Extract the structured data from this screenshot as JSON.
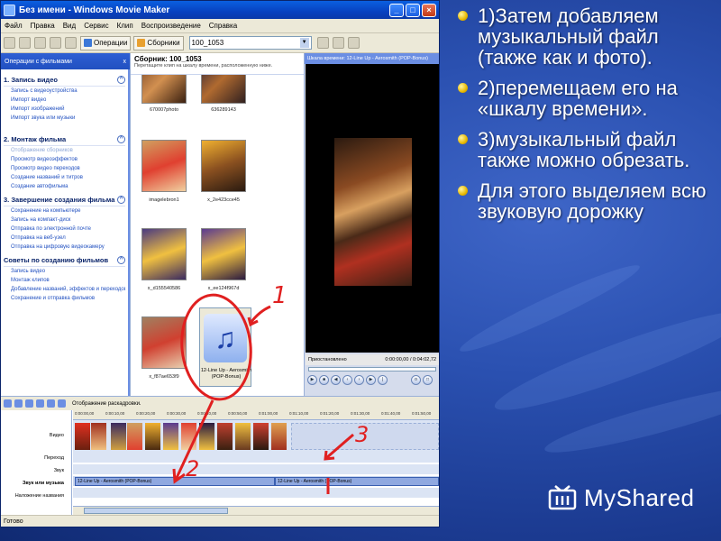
{
  "window": {
    "title": "Без имени - Windows Movie Maker",
    "menu": [
      "Файл",
      "Правка",
      "Вид",
      "Сервис",
      "Клип",
      "Воспроизведение",
      "Справка"
    ],
    "toolbar": {
      "operations_label": "Операции",
      "collections_label": "Сборники",
      "collection_value": "100_1053"
    }
  },
  "tasks": {
    "header": "Операции с фильмами",
    "close": "x",
    "sections": [
      {
        "title": "1. Запись видео",
        "links": [
          "Запись с видеоустройства",
          "Импорт видео",
          "Импорт изображений",
          "Импорт звука или музыки"
        ]
      },
      {
        "title": "2. Монтаж фильма",
        "links": [
          "Отображение сборников",
          "Просмотр видеоэффектов",
          "Просмотр видео переходов",
          "Создание названий и титров",
          "Создание автофильма"
        ]
      },
      {
        "title": "3. Завершение создания фильма",
        "links": [
          "Сохранение на компьютере",
          "Запись на компакт-диск",
          "Отправка по электронной почте",
          "Отправка на веб-узел",
          "Отправка на цифровую видеокамеру"
        ]
      },
      {
        "title": "Советы по созданию фильмов",
        "links": [
          "Запись видео",
          "Монтаж клипов",
          "Добавление названий, эффектов и переходов",
          "Сохранение и отправка фильмов"
        ]
      }
    ]
  },
  "collection": {
    "title": "Сборник: 100_1053",
    "hint": "Перетащите клип на шкалу времени, расположенную ниже.",
    "thumbs": [
      "670007photo",
      "636289143",
      "imagelebron1",
      "x_2e423cce45",
      "x_d155540586",
      "x_ee124f967d",
      "x_f87ae653f9"
    ],
    "music_clip": "12-Line Up - Aerosmith (POP-Bonus)"
  },
  "preview": {
    "header": "Шкала времени: 12-Line Up - Aerosmith (POP-Bonus)",
    "status": "Приостановлено",
    "time": "0:00:00,00 / 0:04:02,72"
  },
  "timeline": {
    "toolbar_label": "Отображение раскадровки.",
    "tracks": [
      "Видео",
      "Переход",
      "Звук",
      "Звук или музыка",
      "Наложение названия"
    ],
    "ruler": [
      "0:00:00,00",
      "0:00:10,00",
      "0:00:20,00",
      "0:00:30,00",
      "0:00:40,00",
      "0:00:50,00",
      "0:01:00,00",
      "0:01:10,00",
      "0:01:20,00",
      "0:01:30,00",
      "0:01:40,00",
      "0:01:50,00"
    ],
    "audio_clips": [
      "12-Line Up - Aerosmith (POP-Bonus)",
      "12-Line Up - Aerosmith (POP-Bonus)"
    ]
  },
  "statusbar": "Готово",
  "annotations": [
    "1",
    "2",
    "3"
  ],
  "slide": {
    "bullets": [
      "1)Затем добавляем музыкальный файл (также как и фото).",
      "2)перемещаем его на «шкалу времени».",
      "3)музыкальный файл также можно обрезать.",
      "Для этого выделяем всю звуковую дорожку"
    ],
    "watermark": "MyShared"
  },
  "colors": {
    "bullet": "#e8b800",
    "annotation": "#e02020",
    "title_bar": "#0a5fe0",
    "slide_bg": "#2a50b0"
  }
}
